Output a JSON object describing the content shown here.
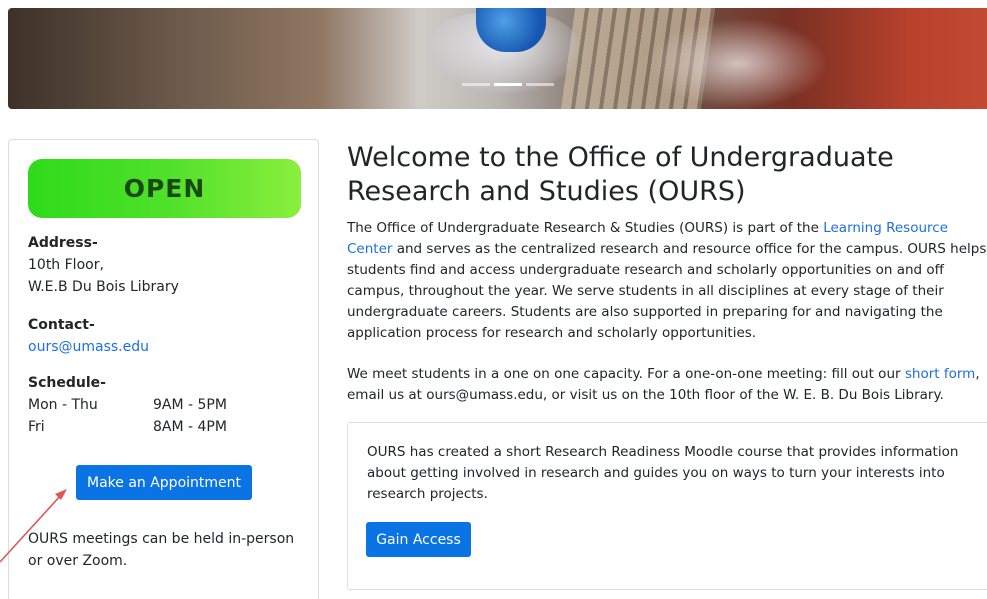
{
  "sidebar": {
    "status_badge": "OPEN",
    "address_label": "Address-",
    "address_line1": "10th Floor,",
    "address_line2": "W.E.B Du Bois Library",
    "contact_label": "Contact-",
    "contact_email": "ours@umass.edu",
    "schedule_label": "Schedule-",
    "schedule": [
      {
        "day": "Mon - Thu",
        "time": "9AM - 5PM"
      },
      {
        "day": "Fri",
        "time": "8AM - 4PM"
      }
    ],
    "appointment_button": "Make an Appointment",
    "meetings_note": "OURS meetings can be held in-person or over Zoom."
  },
  "main": {
    "title": "Welcome to the Office of Undergraduate Research and Studies (OURS)",
    "intro_before_link": "The Office of Undergraduate Research & Studies (OURS) is part of the ",
    "intro_link": "Learning Resource Center",
    "intro_after_link": " and serves as the centralized research and resource office for the campus. OURS helps students find and access undergraduate research and scholarly opportunities on and off campus, throughout the year.  We serve students in all disciplines at every stage of their undergraduate careers. Students are also supported in preparing for and navigating the application process for research and scholarly opportunities.",
    "meet_before_link": "We meet students in a one on one capacity. For a one-on-one meeting: fill out our ",
    "meet_link": "short form",
    "meet_after_link": ", email us at ours@umass.edu, or visit us on the 10th floor of the W. E. B. Du Bois Library.",
    "course_text": "OURS has created a short Research Readiness Moodle course that provides information about getting involved in research and guides you on ways to turn your interests into research projects.",
    "gain_access_button": "Gain Access"
  },
  "colors": {
    "accent": "#0b74e5",
    "link": "#1d6fe0",
    "open_badge": "#2edb1a",
    "annotation_arrow": "#e05555"
  },
  "carousel": {
    "slides": 3,
    "active": 2
  }
}
